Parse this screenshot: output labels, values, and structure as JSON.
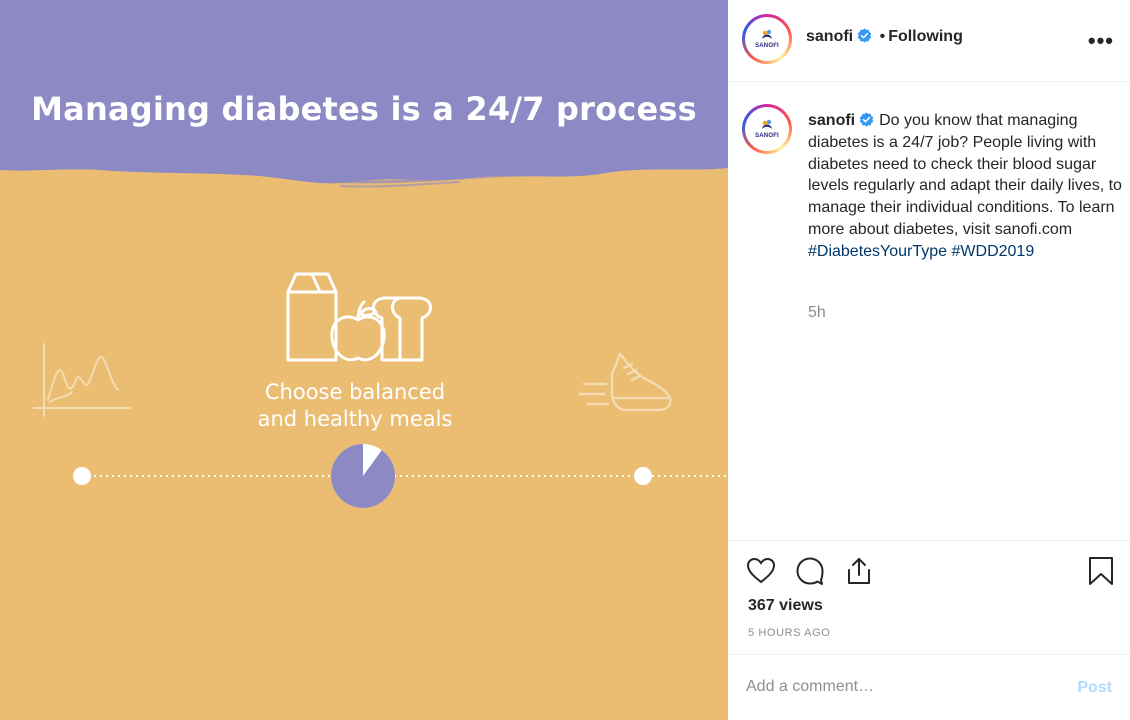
{
  "media": {
    "title": "Managing diabetes is a 24/7 process",
    "caption_line1": "Choose balanced",
    "caption_line2": "and healthy meals",
    "progress_fraction": 0.9,
    "colors": {
      "top_band": "#8d89c4",
      "background": "#ebbd72",
      "accent": "#8d89c4",
      "text": "#ffffff"
    },
    "icons": [
      "chart-icon",
      "milk-carton-icon",
      "apple-icon",
      "bread-icon",
      "running-shoe-icon"
    ]
  },
  "header": {
    "avatar_text": "SANOFI",
    "username": "sanofi",
    "separator": "•",
    "follow_status": "Following",
    "more_label": "•••"
  },
  "caption": {
    "username": "sanofi",
    "text": "Do you know that managing diabetes is a 24/7 job? People living with diabetes need to check their blood sugar levels regularly and adapt their daily lives, to manage their individual conditions. To learn more about diabetes, visit sanofi.com",
    "hashtag1": "#DiabetesYourType",
    "hashtag2": "#WDD2019",
    "age": "5h"
  },
  "actions": {
    "views": "367 views",
    "time_ago": "5 HOURS AGO"
  },
  "comment": {
    "placeholder": "Add a comment…",
    "post_label": "Post",
    "post_color": "#b3dbff"
  }
}
